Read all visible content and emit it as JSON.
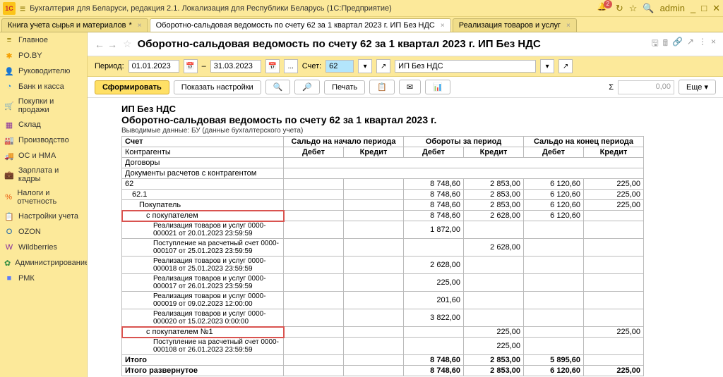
{
  "titlebar": {
    "logo": "1C",
    "title": "Бухгалтерия для Беларуси, редакция 2.1. Локализация для Республики Беларусь   (1С:Предприятие)",
    "notif_count": "2",
    "admin": "admin"
  },
  "tabs": [
    {
      "label": "Книга учета сырья и материалов"
    },
    {
      "label": "Оборотно-сальдовая ведомость по счету 62 за 1 квартал 2023 г. ИП Без НДС"
    },
    {
      "label": "Реализация товаров и услуг"
    }
  ],
  "sidebar": [
    {
      "icon": "≡",
      "color": "#8b7500",
      "label": "Главное"
    },
    {
      "icon": "✱",
      "color": "#f59f00",
      "label": "PO.BY"
    },
    {
      "icon": "👤",
      "color": "#e64980",
      "label": "Руководителю"
    },
    {
      "icon": "◔",
      "color": "#228be6",
      "label": "Банк и касса"
    },
    {
      "icon": "🛒",
      "color": "#5c940d",
      "label": "Покупки и продажи"
    },
    {
      "icon": "▦",
      "color": "#862e9c",
      "label": "Склад"
    },
    {
      "icon": "🏭",
      "color": "#5f3dc4",
      "label": "Производство"
    },
    {
      "icon": "🚚",
      "color": "#2b8a3e",
      "label": "ОС и НМА"
    },
    {
      "icon": "💼",
      "color": "#a61e4d",
      "label": "Зарплата и кадры"
    },
    {
      "icon": "%",
      "color": "#e8590c",
      "label": "Налоги и отчетность"
    },
    {
      "icon": "📋",
      "color": "#c92a2a",
      "label": "Настройки учета"
    },
    {
      "icon": "O",
      "color": "#1864ab",
      "label": "OZON"
    },
    {
      "icon": "W",
      "color": "#862e9c",
      "label": "Wildberries"
    },
    {
      "icon": "✿",
      "color": "#2b8a3e",
      "label": "Администрирование"
    },
    {
      "icon": "■",
      "color": "#5c7cfa",
      "label": "РМК"
    }
  ],
  "doc_header": {
    "title": "Оборотно-сальдовая ведомость по счету 62 за 1 квартал 2023 г. ИП Без НДС"
  },
  "period": {
    "label": "Период:",
    "from": "01.01.2023",
    "to": "31.03.2023",
    "dash": "–",
    "dots": "...",
    "acct_label": "Счет:",
    "acct": "62",
    "org": "ИП Без НДС"
  },
  "actions": {
    "form": "Сформировать",
    "show_settings": "Показать настройки",
    "print": "Печать",
    "more": "Еще",
    "sum": "0,00"
  },
  "report": {
    "org": "ИП Без НДС",
    "title": "Оборотно-сальдовая ведомость по счету 62 за 1 квартал 2023 г.",
    "meta": "Выводимые данные:    БУ (данные бухгалтерского учета)",
    "col_groups": [
      "Сальдо на начало периода",
      "Обороты за период",
      "Сальдо на конец периода"
    ],
    "subcols": [
      "Дебет",
      "Кредит",
      "Дебет",
      "Кредит",
      "Дебет",
      "Кредит"
    ],
    "row_labels": {
      "account": "Счет",
      "counterparties": "Контрагенты",
      "contracts": "Договоры",
      "docs": "Документы расчетов с контрагентом",
      "total": "Итого",
      "total_exp": "Итого развернутое"
    },
    "rows": [
      {
        "indent": 0,
        "label": "62",
        "vals": [
          "",
          "",
          "8 748,60",
          "2 853,00",
          "6 120,60",
          "225,00"
        ]
      },
      {
        "indent": 1,
        "label": "62.1",
        "vals": [
          "",
          "",
          "8 748,60",
          "2 853,00",
          "6 120,60",
          "225,00"
        ]
      },
      {
        "indent": 2,
        "label": "Покупатель",
        "vals": [
          "",
          "",
          "8 748,60",
          "2 853,00",
          "6 120,60",
          "225,00"
        ]
      },
      {
        "indent": 3,
        "label": "с покупателем",
        "hl": true,
        "vals": [
          "",
          "",
          "8 748,60",
          "2 628,00",
          "6 120,60",
          ""
        ]
      },
      {
        "indent": 4,
        "label": "Реализация товаров и услуг 0000-000021 от 20.01.2023 23:59:59",
        "doc": true,
        "vals": [
          "",
          "",
          "1 872,00",
          "",
          "",
          ""
        ]
      },
      {
        "indent": 4,
        "label": "Поступление на расчетный счет 0000-000107 от 25.01.2023 23:59:59",
        "doc": true,
        "vals": [
          "",
          "",
          "",
          "2 628,00",
          "",
          ""
        ]
      },
      {
        "indent": 4,
        "label": "Реализация товаров и услуг 0000-000018 от 25.01.2023 23:59:59",
        "doc": true,
        "vals": [
          "",
          "",
          "2 628,00",
          "",
          "",
          ""
        ]
      },
      {
        "indent": 4,
        "label": "Реализация товаров и услуг 0000-000017 от 26.01.2023 23:59:59",
        "doc": true,
        "vals": [
          "",
          "",
          "225,00",
          "",
          "",
          ""
        ]
      },
      {
        "indent": 4,
        "label": "Реализация товаров и услуг 0000-000019 от 09.02.2023 12:00:00",
        "doc": true,
        "vals": [
          "",
          "",
          "201,60",
          "",
          "",
          ""
        ]
      },
      {
        "indent": 4,
        "label": "Реализация товаров и услуг 0000-000020 от 15.02.2023 0:00:00",
        "doc": true,
        "vals": [
          "",
          "",
          "3 822,00",
          "",
          "",
          ""
        ]
      },
      {
        "indent": 3,
        "label": "с покупателем №1",
        "hl": true,
        "vals": [
          "",
          "",
          "",
          "225,00",
          "",
          "225,00"
        ]
      },
      {
        "indent": 4,
        "label": "Поступление на расчетный счет 0000-000108 от 26.01.2023 23:59:59",
        "doc": true,
        "vals": [
          "",
          "",
          "",
          "225,00",
          "",
          ""
        ]
      }
    ],
    "totals": [
      {
        "label": "Итого",
        "vals": [
          "",
          "",
          "8 748,60",
          "2 853,00",
          "5 895,60",
          ""
        ]
      },
      {
        "label": "Итого развернутое",
        "vals": [
          "",
          "",
          "8 748,60",
          "2 853,00",
          "6 120,60",
          "225,00"
        ]
      }
    ]
  }
}
